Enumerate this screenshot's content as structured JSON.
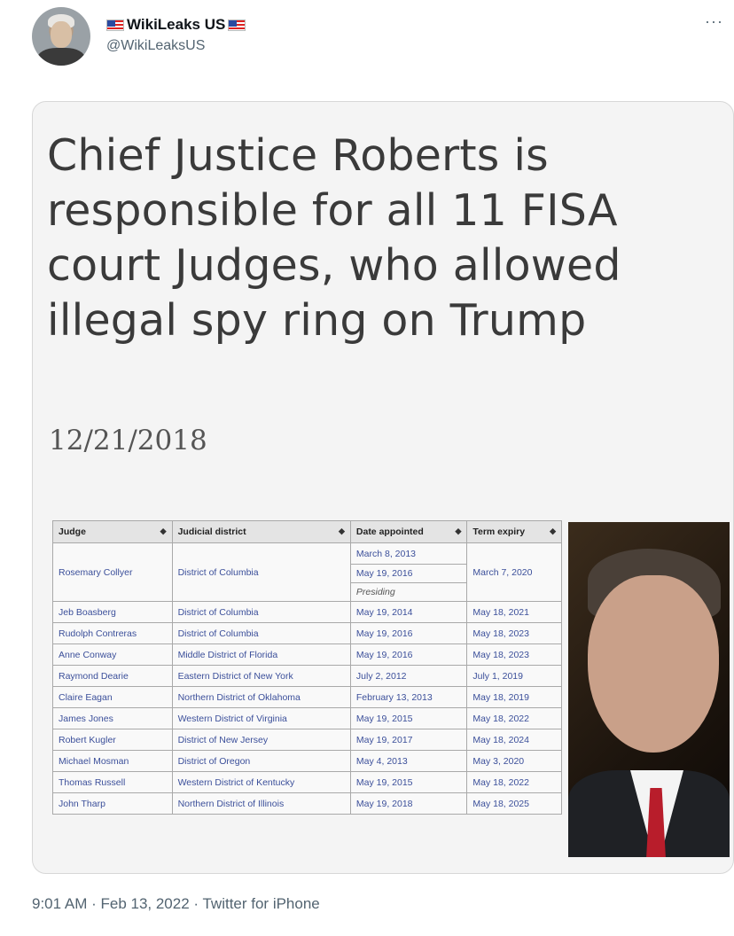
{
  "tweet": {
    "display_name": "WikiLeaks US",
    "handle": "@WikiLeaksUS",
    "footer": "9:01 AM · Feb 13, 2022 · Twitter for iPhone"
  },
  "card": {
    "headline": "Chief Justice Roberts is responsible for all 11 FISA court Judges, who allowed illegal spy ring on Trump",
    "date": "12/21/2018"
  },
  "table": {
    "headers": [
      "Judge",
      "Judicial district",
      "Date appointed",
      "Term expiry"
    ],
    "first_row": {
      "judge": "Rosemary Collyer",
      "district": "District of Columbia",
      "date1": "March 8, 2013",
      "date2": "May 19, 2016",
      "note": "Presiding",
      "expiry": "March 7, 2020"
    },
    "rows": [
      {
        "judge": "Jeb Boasberg",
        "district": "District of Columbia",
        "date": "May 19, 2014",
        "expiry": "May 18, 2021"
      },
      {
        "judge": "Rudolph Contreras",
        "district": "District of Columbia",
        "date": "May 19, 2016",
        "expiry": "May 18, 2023"
      },
      {
        "judge": "Anne Conway",
        "district": "Middle District of Florida",
        "date": "May 19, 2016",
        "expiry": "May 18, 2023"
      },
      {
        "judge": "Raymond Dearie",
        "district": "Eastern District of New York",
        "date": "July 2, 2012",
        "expiry": "July 1, 2019"
      },
      {
        "judge": "Claire Eagan",
        "district": "Northern District of Oklahoma",
        "date": "February 13, 2013",
        "expiry": "May 18, 2019"
      },
      {
        "judge": "James Jones",
        "district": "Western District of Virginia",
        "date": "May 19, 2015",
        "expiry": "May 18, 2022"
      },
      {
        "judge": "Robert Kugler",
        "district": "District of New Jersey",
        "date": "May 19, 2017",
        "expiry": "May 18, 2024"
      },
      {
        "judge": "Michael Mosman",
        "district": "District of Oregon",
        "date": "May 4, 2013",
        "expiry": "May 3, 2020"
      },
      {
        "judge": "Thomas Russell",
        "district": "Western District of Kentucky",
        "date": "May 19, 2015",
        "expiry": "May 18, 2022"
      },
      {
        "judge": "John Tharp",
        "district": "Northern District of Illinois",
        "date": "May 19, 2018",
        "expiry": "May 18, 2025"
      }
    ]
  }
}
